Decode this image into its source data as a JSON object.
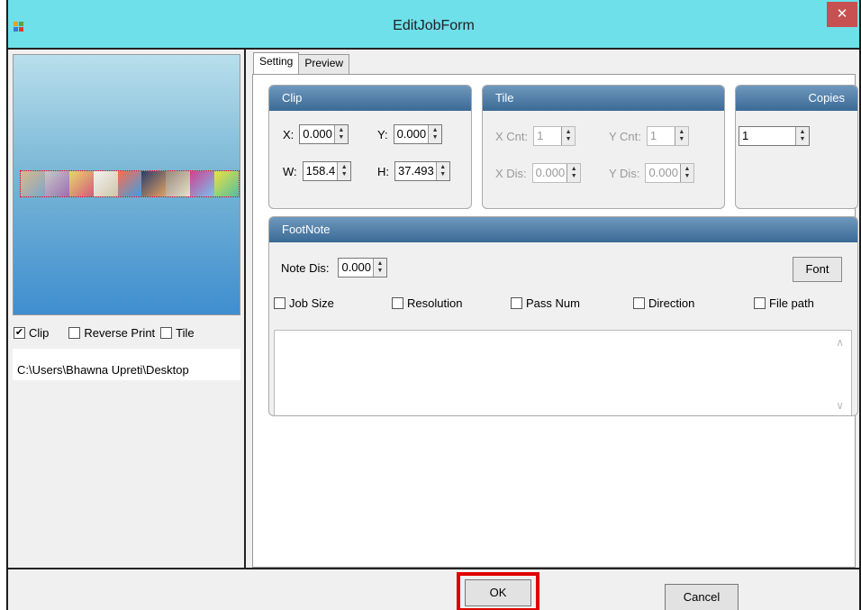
{
  "window": {
    "title": "EditJobForm",
    "close_glyph": "✕"
  },
  "left": {
    "checks": [
      {
        "label": "Clip",
        "checked": true
      },
      {
        "label": "Reverse Print",
        "checked": false
      },
      {
        "label": "Tile",
        "checked": false
      }
    ],
    "path": "C:\\Users\\Bhawna Upreti\\Desktop"
  },
  "tabs": [
    "Setting",
    "Preview"
  ],
  "clip": {
    "header": "Clip",
    "x_label": "X:",
    "x_value": "0.000",
    "y_label": "Y:",
    "y_value": "0.000",
    "w_label": "W:",
    "w_value": "158.4",
    "h_label": "H:",
    "h_value": "37.493"
  },
  "tile": {
    "header": "Tile",
    "xcnt_label": "X Cnt:",
    "xcnt_value": "1",
    "ycnt_label": "Y Cnt:",
    "ycnt_value": "1",
    "xdis_label": "X Dis:",
    "xdis_value": "0.000",
    "ydis_label": "Y Dis:",
    "ydis_value": "0.000"
  },
  "copies": {
    "header": "Copies",
    "value": "1"
  },
  "footnote": {
    "header": "FootNote",
    "note_dis_label": "Note Dis:",
    "note_dis_value": "0.000",
    "font_button": "Font",
    "options": [
      {
        "label": "Job Size",
        "checked": false
      },
      {
        "label": "Resolution",
        "checked": false
      },
      {
        "label": "Pass Num",
        "checked": false
      },
      {
        "label": "Direction",
        "checked": false
      },
      {
        "label": "File path",
        "checked": false
      }
    ]
  },
  "buttons": {
    "ok": "OK",
    "cancel": "Cancel"
  },
  "colors": {
    "titlebar": "#6de0ea",
    "group_header": "#4a7aa6",
    "highlight": "#e00000",
    "close": "#c75050"
  }
}
